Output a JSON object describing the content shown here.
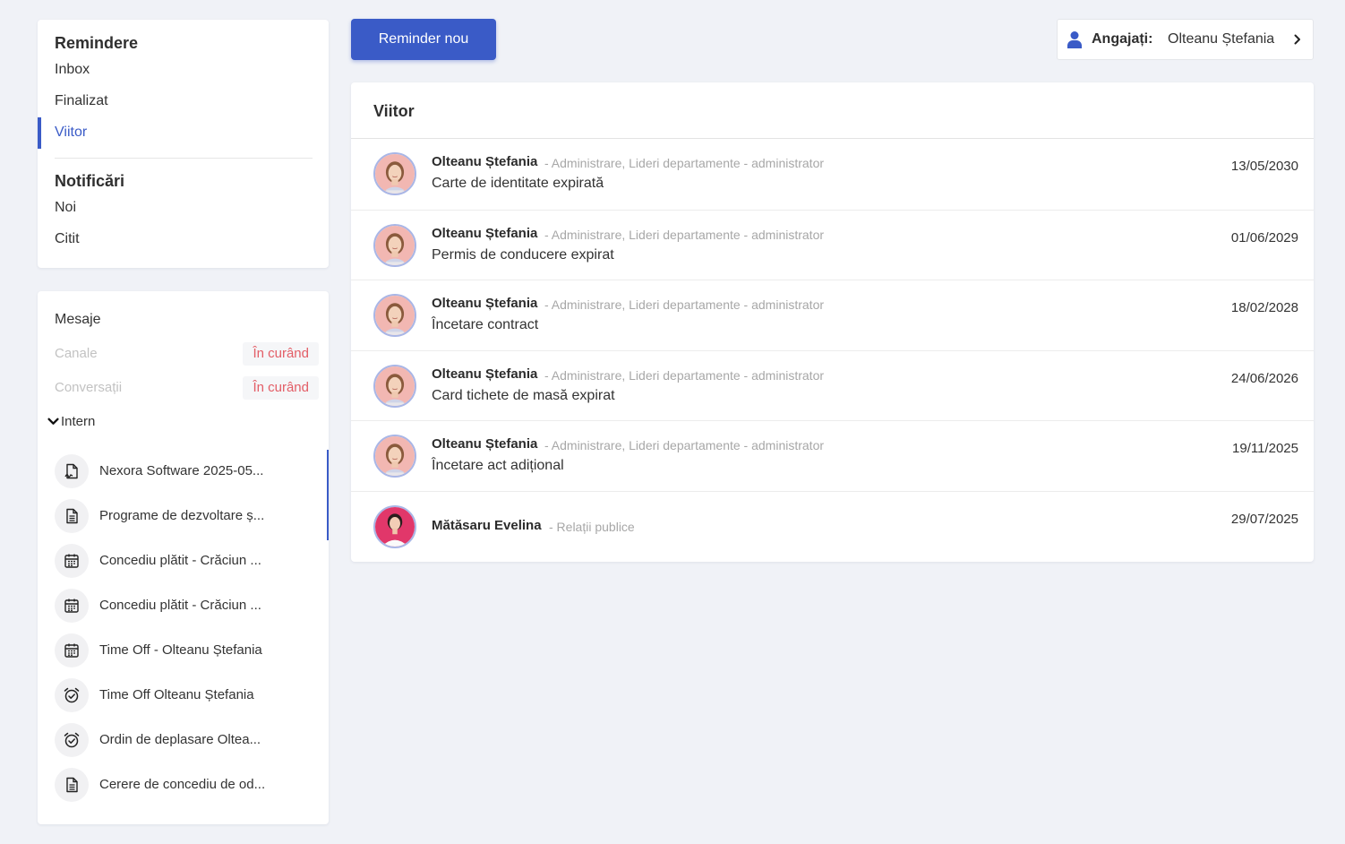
{
  "nav": {
    "reminders_heading": "Remindere",
    "reminders": [
      {
        "label": "Inbox"
      },
      {
        "label": "Finalizat"
      },
      {
        "label": "Viitor"
      }
    ],
    "notifications_heading": "Notificări",
    "notifications": [
      {
        "label": "Noi"
      },
      {
        "label": "Citit"
      }
    ],
    "active_item": "Viitor"
  },
  "messages": {
    "title": "Mesaje",
    "channels": [
      {
        "label": "Canale",
        "badge": "În curând"
      },
      {
        "label": "Conversații",
        "badge": "În curând"
      }
    ],
    "intern_label": "Intern",
    "items": [
      {
        "label": "Nexora Software 2025-05...",
        "icon": "signed-document-icon"
      },
      {
        "label": "Programe de dezvoltare ș...",
        "icon": "document-icon"
      },
      {
        "label": "Concediu plătit - Crăciun ...",
        "icon": "calendar-icon"
      },
      {
        "label": "Concediu plătit - Crăciun ...",
        "icon": "calendar-icon"
      },
      {
        "label": "Time Off - Olteanu Ștefania",
        "icon": "calendar-icon"
      },
      {
        "label": "Time Off Olteanu Ștefania",
        "icon": "alarm-check-icon"
      },
      {
        "label": "Ordin de deplasare Oltea...",
        "icon": "alarm-check-icon"
      },
      {
        "label": "Cerere de concediu de od...",
        "icon": "document-icon"
      }
    ]
  },
  "toolbar": {
    "new_reminder_label": "Reminder nou",
    "employee_label": "Angajați:",
    "employee_value": "Olteanu Ștefania"
  },
  "list": {
    "title": "Viitor",
    "rows": [
      {
        "name": "Olteanu Ștefania",
        "dept": "- Administrare, Lideri departamente - administrator",
        "subject": "Carte de identitate expirată",
        "date": "13/05/2030",
        "avatar": "woman-1"
      },
      {
        "name": "Olteanu Ștefania",
        "dept": "- Administrare, Lideri departamente - administrator",
        "subject": "Permis de conducere expirat",
        "date": "01/06/2029",
        "avatar": "woman-1"
      },
      {
        "name": "Olteanu Ștefania",
        "dept": "- Administrare, Lideri departamente - administrator",
        "subject": "Încetare contract",
        "date": "18/02/2028",
        "avatar": "woman-1"
      },
      {
        "name": "Olteanu Ștefania",
        "dept": "- Administrare, Lideri departamente - administrator",
        "subject": "Card tichete de masă expirat",
        "date": "24/06/2026",
        "avatar": "woman-1"
      },
      {
        "name": "Olteanu Ștefania",
        "dept": "- Administrare, Lideri departamente - administrator",
        "subject": "Încetare act adițional",
        "date": "19/11/2025",
        "avatar": "woman-1"
      },
      {
        "name": "Mătăsaru Evelina",
        "dept": "- Relații publice",
        "subject": "",
        "date": "29/07/2025",
        "avatar": "woman-2"
      }
    ]
  },
  "colors": {
    "accent": "#3a5bc7",
    "badge_text": "#e35d66",
    "background": "#f0f2f7"
  }
}
